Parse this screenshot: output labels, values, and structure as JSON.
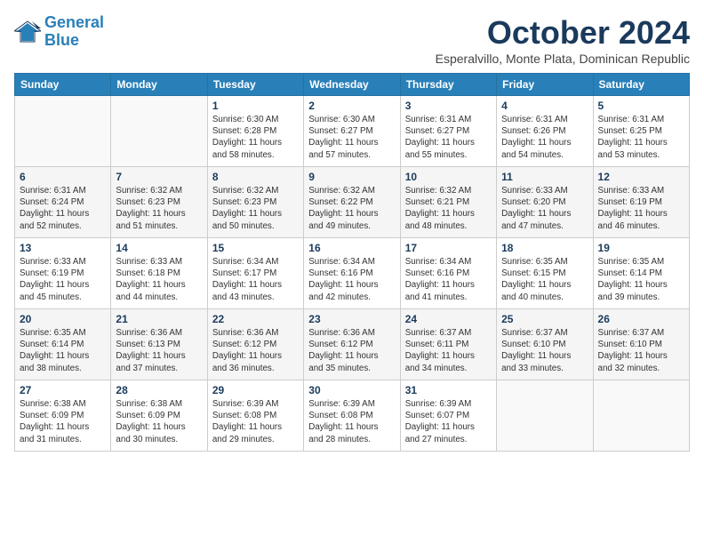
{
  "header": {
    "logo_line1": "General",
    "logo_line2": "Blue",
    "month_title": "October 2024",
    "location": "Esperalvillo, Monte Plata, Dominican Republic"
  },
  "weekdays": [
    "Sunday",
    "Monday",
    "Tuesday",
    "Wednesday",
    "Thursday",
    "Friday",
    "Saturday"
  ],
  "weeks": [
    [
      {
        "day": "",
        "info": ""
      },
      {
        "day": "",
        "info": ""
      },
      {
        "day": "1",
        "info": "Sunrise: 6:30 AM\nSunset: 6:28 PM\nDaylight: 11 hours\nand 58 minutes."
      },
      {
        "day": "2",
        "info": "Sunrise: 6:30 AM\nSunset: 6:27 PM\nDaylight: 11 hours\nand 57 minutes."
      },
      {
        "day": "3",
        "info": "Sunrise: 6:31 AM\nSunset: 6:27 PM\nDaylight: 11 hours\nand 55 minutes."
      },
      {
        "day": "4",
        "info": "Sunrise: 6:31 AM\nSunset: 6:26 PM\nDaylight: 11 hours\nand 54 minutes."
      },
      {
        "day": "5",
        "info": "Sunrise: 6:31 AM\nSunset: 6:25 PM\nDaylight: 11 hours\nand 53 minutes."
      }
    ],
    [
      {
        "day": "6",
        "info": "Sunrise: 6:31 AM\nSunset: 6:24 PM\nDaylight: 11 hours\nand 52 minutes."
      },
      {
        "day": "7",
        "info": "Sunrise: 6:32 AM\nSunset: 6:23 PM\nDaylight: 11 hours\nand 51 minutes."
      },
      {
        "day": "8",
        "info": "Sunrise: 6:32 AM\nSunset: 6:23 PM\nDaylight: 11 hours\nand 50 minutes."
      },
      {
        "day": "9",
        "info": "Sunrise: 6:32 AM\nSunset: 6:22 PM\nDaylight: 11 hours\nand 49 minutes."
      },
      {
        "day": "10",
        "info": "Sunrise: 6:32 AM\nSunset: 6:21 PM\nDaylight: 11 hours\nand 48 minutes."
      },
      {
        "day": "11",
        "info": "Sunrise: 6:33 AM\nSunset: 6:20 PM\nDaylight: 11 hours\nand 47 minutes."
      },
      {
        "day": "12",
        "info": "Sunrise: 6:33 AM\nSunset: 6:19 PM\nDaylight: 11 hours\nand 46 minutes."
      }
    ],
    [
      {
        "day": "13",
        "info": "Sunrise: 6:33 AM\nSunset: 6:19 PM\nDaylight: 11 hours\nand 45 minutes."
      },
      {
        "day": "14",
        "info": "Sunrise: 6:33 AM\nSunset: 6:18 PM\nDaylight: 11 hours\nand 44 minutes."
      },
      {
        "day": "15",
        "info": "Sunrise: 6:34 AM\nSunset: 6:17 PM\nDaylight: 11 hours\nand 43 minutes."
      },
      {
        "day": "16",
        "info": "Sunrise: 6:34 AM\nSunset: 6:16 PM\nDaylight: 11 hours\nand 42 minutes."
      },
      {
        "day": "17",
        "info": "Sunrise: 6:34 AM\nSunset: 6:16 PM\nDaylight: 11 hours\nand 41 minutes."
      },
      {
        "day": "18",
        "info": "Sunrise: 6:35 AM\nSunset: 6:15 PM\nDaylight: 11 hours\nand 40 minutes."
      },
      {
        "day": "19",
        "info": "Sunrise: 6:35 AM\nSunset: 6:14 PM\nDaylight: 11 hours\nand 39 minutes."
      }
    ],
    [
      {
        "day": "20",
        "info": "Sunrise: 6:35 AM\nSunset: 6:14 PM\nDaylight: 11 hours\nand 38 minutes."
      },
      {
        "day": "21",
        "info": "Sunrise: 6:36 AM\nSunset: 6:13 PM\nDaylight: 11 hours\nand 37 minutes."
      },
      {
        "day": "22",
        "info": "Sunrise: 6:36 AM\nSunset: 6:12 PM\nDaylight: 11 hours\nand 36 minutes."
      },
      {
        "day": "23",
        "info": "Sunrise: 6:36 AM\nSunset: 6:12 PM\nDaylight: 11 hours\nand 35 minutes."
      },
      {
        "day": "24",
        "info": "Sunrise: 6:37 AM\nSunset: 6:11 PM\nDaylight: 11 hours\nand 34 minutes."
      },
      {
        "day": "25",
        "info": "Sunrise: 6:37 AM\nSunset: 6:10 PM\nDaylight: 11 hours\nand 33 minutes."
      },
      {
        "day": "26",
        "info": "Sunrise: 6:37 AM\nSunset: 6:10 PM\nDaylight: 11 hours\nand 32 minutes."
      }
    ],
    [
      {
        "day": "27",
        "info": "Sunrise: 6:38 AM\nSunset: 6:09 PM\nDaylight: 11 hours\nand 31 minutes."
      },
      {
        "day": "28",
        "info": "Sunrise: 6:38 AM\nSunset: 6:09 PM\nDaylight: 11 hours\nand 30 minutes."
      },
      {
        "day": "29",
        "info": "Sunrise: 6:39 AM\nSunset: 6:08 PM\nDaylight: 11 hours\nand 29 minutes."
      },
      {
        "day": "30",
        "info": "Sunrise: 6:39 AM\nSunset: 6:08 PM\nDaylight: 11 hours\nand 28 minutes."
      },
      {
        "day": "31",
        "info": "Sunrise: 6:39 AM\nSunset: 6:07 PM\nDaylight: 11 hours\nand 27 minutes."
      },
      {
        "day": "",
        "info": ""
      },
      {
        "day": "",
        "info": ""
      }
    ]
  ]
}
